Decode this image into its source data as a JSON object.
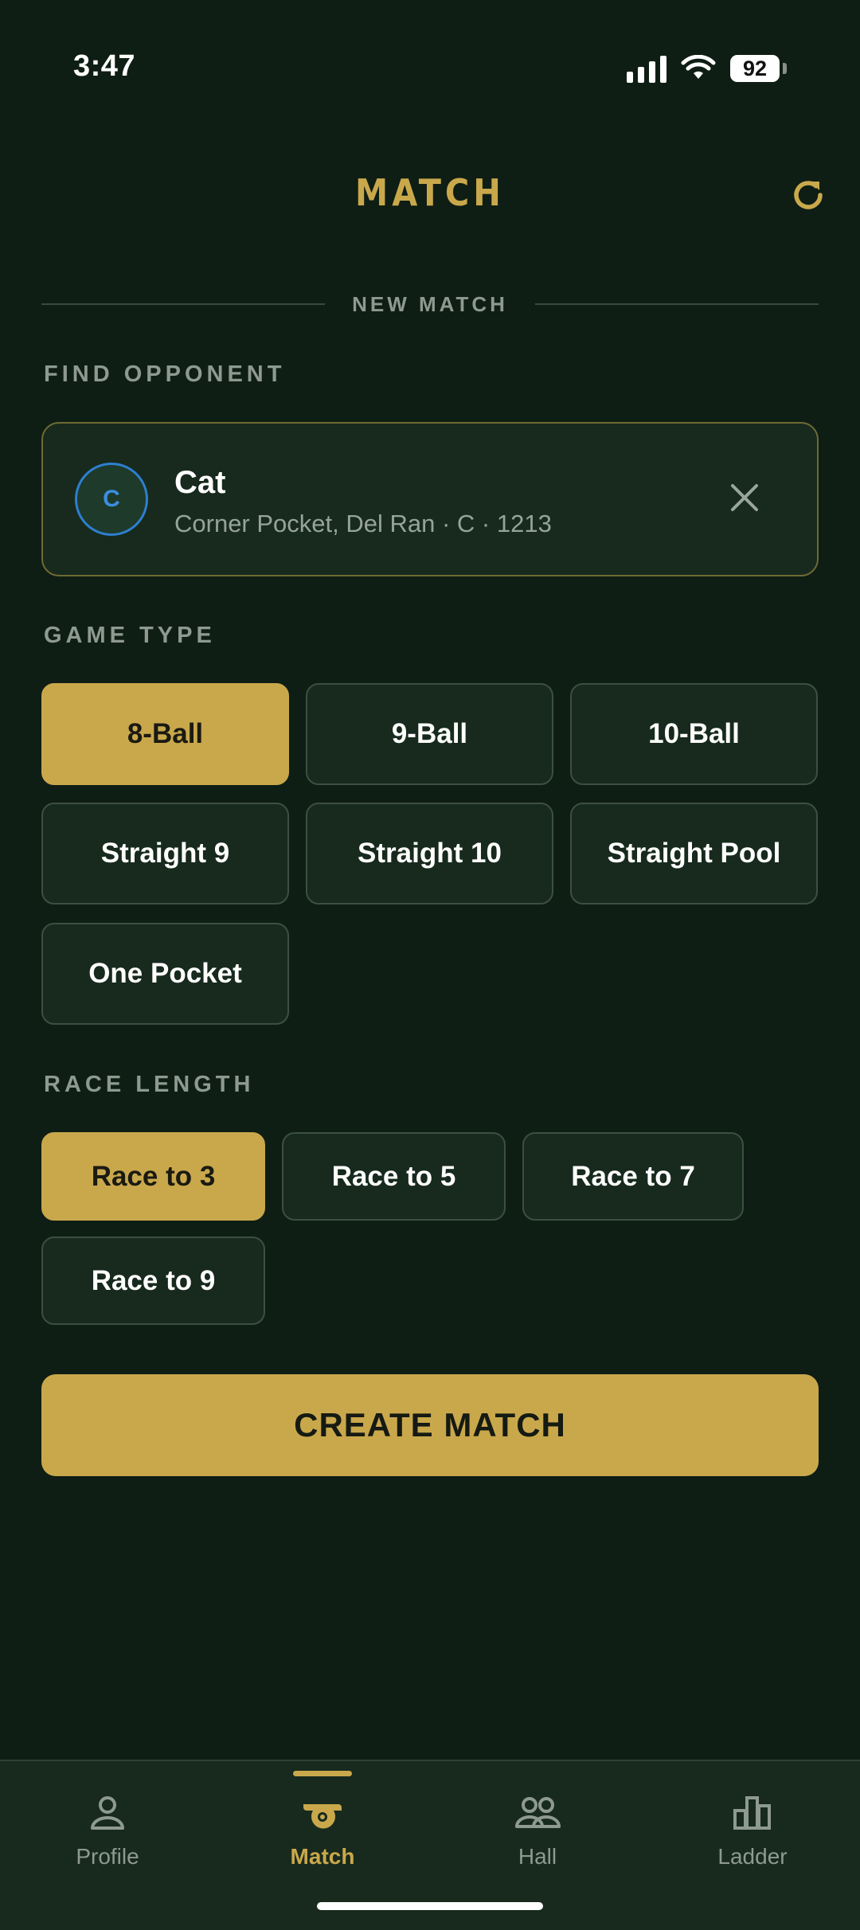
{
  "status": {
    "time": "3:47",
    "battery": "92"
  },
  "header": {
    "title": "MATCH"
  },
  "section": {
    "title": "NEW MATCH"
  },
  "opponent": {
    "label": "FIND OPPONENT",
    "initial": "C",
    "name": "Cat",
    "detail": "Corner Pocket, Del Ran  ·  C · 1213"
  },
  "game_type": {
    "label": "GAME TYPE",
    "options": [
      "8-Ball",
      "9-Ball",
      "10-Ball",
      "Straight 9",
      "Straight 10",
      "Straight Pool",
      "One Pocket"
    ],
    "selected": "8-Ball"
  },
  "race_length": {
    "label": "RACE LENGTH",
    "options": [
      "Race to 3",
      "Race to 5",
      "Race to 7",
      "Race to 9"
    ],
    "selected": "Race to 3"
  },
  "actions": {
    "create": "CREATE MATCH"
  },
  "tabs": [
    {
      "label": "Profile",
      "icon": "person-icon"
    },
    {
      "label": "Match",
      "icon": "whistle-icon",
      "active": true
    },
    {
      "label": "Hall",
      "icon": "people-icon"
    },
    {
      "label": "Ladder",
      "icon": "bar-chart-icon"
    }
  ],
  "colors": {
    "accent": "#c9a84c",
    "background": "#0f1e14",
    "surface": "#172a1d",
    "avatar_ring": "#2d7fd0"
  }
}
